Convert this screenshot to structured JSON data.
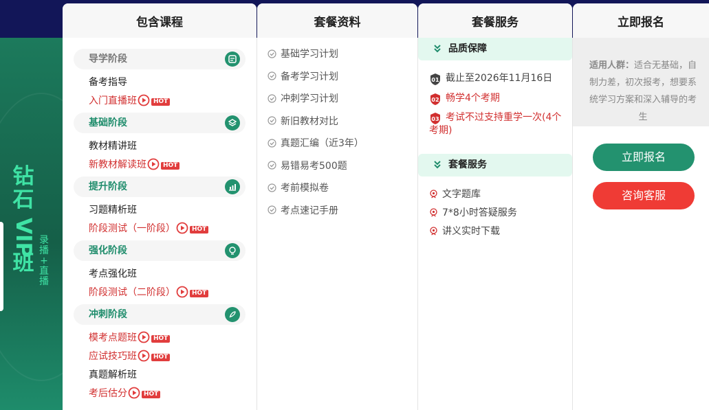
{
  "left_panel": {
    "title_chars": [
      "钻",
      "石",
      "VIP",
      "班"
    ],
    "sub_chars": [
      "录",
      "播",
      "+",
      "直",
      "播"
    ]
  },
  "columns": {
    "courses": "包含课程",
    "materials": "套餐资料",
    "services": "套餐服务",
    "enroll": "立即报名"
  },
  "stages": [
    {
      "label": "导学阶段",
      "icon": "book-icon",
      "items": [
        {
          "text": "备考指导",
          "red": false,
          "play": false,
          "hot": false
        },
        {
          "text": "入门直播班",
          "red": true,
          "play": true,
          "hot": true
        }
      ]
    },
    {
      "label": "基础阶段",
      "icon": "layers-icon",
      "items": [
        {
          "text": "教材精讲班",
          "red": false,
          "play": false,
          "hot": false
        },
        {
          "text": "新教材解读班",
          "red": true,
          "play": true,
          "hot": true
        }
      ]
    },
    {
      "label": "提升阶段",
      "icon": "chart-icon",
      "items": [
        {
          "text": "习题精析班",
          "red": false,
          "play": false,
          "hot": false
        },
        {
          "text": "阶段测试（一阶段）",
          "red": true,
          "play": true,
          "hot": true
        }
      ]
    },
    {
      "label": "强化阶段",
      "icon": "bulb-icon",
      "items": [
        {
          "text": "考点强化班",
          "red": false,
          "play": false,
          "hot": false
        },
        {
          "text": "阶段测试（二阶段）",
          "red": true,
          "play": true,
          "hot": true
        }
      ]
    },
    {
      "label": "冲刺阶段",
      "icon": "rocket-icon",
      "items": [
        {
          "text": "模考点题班",
          "red": true,
          "play": true,
          "hot": true
        },
        {
          "text": "应试技巧班",
          "red": true,
          "play": true,
          "hot": true
        },
        {
          "text": "真题解析班",
          "red": false,
          "play": false,
          "hot": false
        },
        {
          "text": "考后估分",
          "red": true,
          "play": true,
          "hot": true
        }
      ]
    }
  ],
  "hot_label": "HOT",
  "materials": [
    "基础学习计划",
    "备考学习计划",
    "冲刺学习计划",
    "新旧教材对比",
    "真题汇编（近3年）",
    "易错易考500题",
    "考前模拟卷",
    "考点速记手册"
  ],
  "quality": {
    "title": "品质保障",
    "items": [
      {
        "num": "01",
        "text": "截止至2026年11月16日",
        "red": false
      },
      {
        "num": "02",
        "text": "畅学4个考期",
        "red": true
      },
      {
        "num": "03",
        "text": "考试不过支持重学一次(4个考期)",
        "red": true
      }
    ]
  },
  "package_service": {
    "title": "套餐服务",
    "items": [
      "文字题库",
      "7*8小时答疑服务",
      "讲义实时下载"
    ]
  },
  "suitable": {
    "label": "适用人群：",
    "text": "适合无基础，自制力差，初次报考，想要系统学习方案和深入辅导的考生"
  },
  "buttons": {
    "enroll": "立即报名",
    "consult": "咨询客服"
  },
  "colors": {
    "accent_green": "#23926f",
    "hot_red": "#e13d3d",
    "title_mint": "#3fe3a5",
    "dark_navy": "#121658"
  }
}
